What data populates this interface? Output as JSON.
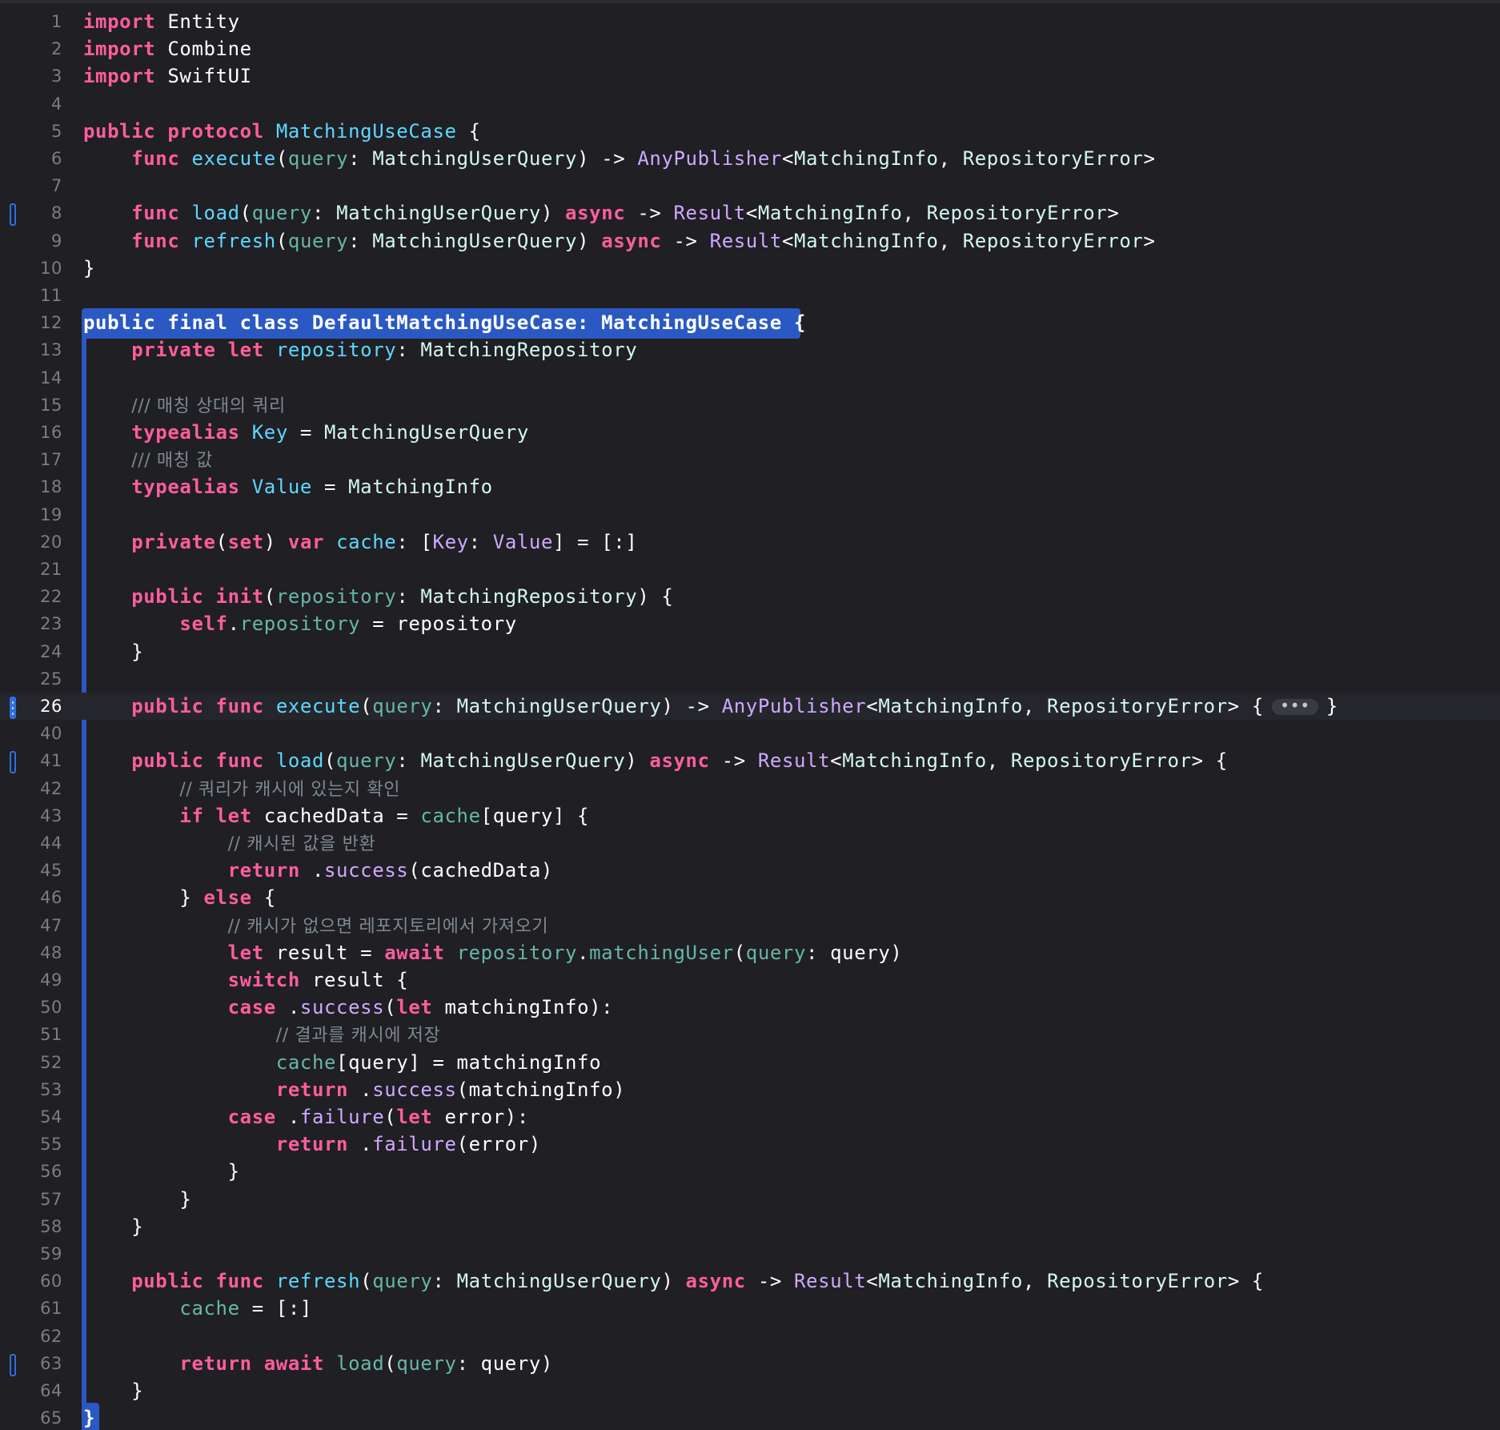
{
  "editor": {
    "language": "Swift",
    "fold_chip": "•••",
    "lines": [
      {
        "n": "1",
        "tokens": [
          [
            "kw",
            "import"
          ],
          [
            "pl",
            " Entity"
          ]
        ]
      },
      {
        "n": "2",
        "tokens": [
          [
            "kw",
            "import"
          ],
          [
            "pl",
            " Combine"
          ]
        ]
      },
      {
        "n": "3",
        "tokens": [
          [
            "kw",
            "import"
          ],
          [
            "pl",
            " SwiftUI"
          ]
        ]
      },
      {
        "n": "4",
        "tokens": []
      },
      {
        "n": "5",
        "tokens": [
          [
            "kw",
            "public protocol"
          ],
          [
            "pl",
            " "
          ],
          [
            "decl",
            "MatchingUseCase"
          ],
          [
            "pl",
            " {"
          ]
        ]
      },
      {
        "n": "6",
        "tokens": [
          [
            "pl",
            "    "
          ],
          [
            "kw",
            "func"
          ],
          [
            "pl",
            " "
          ],
          [
            "decl",
            "execute"
          ],
          [
            "pl",
            "("
          ],
          [
            "param",
            "query"
          ],
          [
            "pl",
            ": "
          ],
          [
            "ty",
            "MatchingUserQuery"
          ],
          [
            "pl",
            ") -> "
          ],
          [
            "sys",
            "AnyPublisher"
          ],
          [
            "pl",
            "<"
          ],
          [
            "ty",
            "MatchingInfo"
          ],
          [
            "pl",
            ", "
          ],
          [
            "ty",
            "RepositoryError"
          ],
          [
            "pl",
            ">"
          ]
        ]
      },
      {
        "n": "7",
        "tokens": []
      },
      {
        "n": "8",
        "marker": "bar",
        "tokens": [
          [
            "pl",
            "    "
          ],
          [
            "kw",
            "func"
          ],
          [
            "pl",
            " "
          ],
          [
            "decl",
            "load"
          ],
          [
            "pl",
            "("
          ],
          [
            "param",
            "query"
          ],
          [
            "pl",
            ": "
          ],
          [
            "ty",
            "MatchingUserQuery"
          ],
          [
            "pl",
            ") "
          ],
          [
            "kw",
            "async"
          ],
          [
            "pl",
            " -> "
          ],
          [
            "sys",
            "Result"
          ],
          [
            "pl",
            "<"
          ],
          [
            "ty",
            "MatchingInfo"
          ],
          [
            "pl",
            ", "
          ],
          [
            "ty",
            "RepositoryError"
          ],
          [
            "pl",
            ">"
          ]
        ]
      },
      {
        "n": "9",
        "tokens": [
          [
            "pl",
            "    "
          ],
          [
            "kw",
            "func"
          ],
          [
            "pl",
            " "
          ],
          [
            "decl",
            "refresh"
          ],
          [
            "pl",
            "("
          ],
          [
            "param",
            "query"
          ],
          [
            "pl",
            ": "
          ],
          [
            "ty",
            "MatchingUserQuery"
          ],
          [
            "pl",
            ") "
          ],
          [
            "kw",
            "async"
          ],
          [
            "pl",
            " -> "
          ],
          [
            "sys",
            "Result"
          ],
          [
            "pl",
            "<"
          ],
          [
            "ty",
            "MatchingInfo"
          ],
          [
            "pl",
            ", "
          ],
          [
            "ty",
            "RepositoryError"
          ],
          [
            "pl",
            ">"
          ]
        ]
      },
      {
        "n": "10",
        "tokens": [
          [
            "pl",
            "}"
          ]
        ]
      },
      {
        "n": "11",
        "tokens": []
      },
      {
        "n": "12",
        "highlight": true,
        "tokens": [
          [
            "hl",
            "public final class DefaultMatchingUseCase: MatchingUseCase {"
          ]
        ]
      },
      {
        "n": "13",
        "tokens": [
          [
            "pl",
            "    "
          ],
          [
            "kw",
            "private let"
          ],
          [
            "pl",
            " "
          ],
          [
            "decl",
            "repository"
          ],
          [
            "pl",
            ": "
          ],
          [
            "ty",
            "MatchingRepository"
          ]
        ]
      },
      {
        "n": "14",
        "tokens": []
      },
      {
        "n": "15",
        "tokens": [
          [
            "pl",
            "    "
          ],
          [
            "cm",
            "/// 매칭 상대의 쿼리"
          ]
        ]
      },
      {
        "n": "16",
        "tokens": [
          [
            "pl",
            "    "
          ],
          [
            "kw",
            "typealias"
          ],
          [
            "pl",
            " "
          ],
          [
            "decl",
            "Key"
          ],
          [
            "pl",
            " = "
          ],
          [
            "ty",
            "MatchingUserQuery"
          ]
        ]
      },
      {
        "n": "17",
        "tokens": [
          [
            "pl",
            "    "
          ],
          [
            "cm",
            "/// 매칭 값"
          ]
        ]
      },
      {
        "n": "18",
        "tokens": [
          [
            "pl",
            "    "
          ],
          [
            "kw",
            "typealias"
          ],
          [
            "pl",
            " "
          ],
          [
            "decl",
            "Value"
          ],
          [
            "pl",
            " = "
          ],
          [
            "ty",
            "MatchingInfo"
          ]
        ]
      },
      {
        "n": "19",
        "tokens": []
      },
      {
        "n": "20",
        "tokens": [
          [
            "pl",
            "    "
          ],
          [
            "kw",
            "private"
          ],
          [
            "pl",
            "("
          ],
          [
            "kw",
            "set"
          ],
          [
            "pl",
            ") "
          ],
          [
            "kw",
            "var"
          ],
          [
            "pl",
            " "
          ],
          [
            "decl",
            "cache"
          ],
          [
            "pl",
            ": ["
          ],
          [
            "sys",
            "Key"
          ],
          [
            "pl",
            ": "
          ],
          [
            "sys",
            "Value"
          ],
          [
            "pl",
            "] = [:]"
          ]
        ]
      },
      {
        "n": "21",
        "tokens": []
      },
      {
        "n": "22",
        "tokens": [
          [
            "pl",
            "    "
          ],
          [
            "kw",
            "public init"
          ],
          [
            "pl",
            "("
          ],
          [
            "param",
            "repository"
          ],
          [
            "pl",
            ": "
          ],
          [
            "ty",
            "MatchingRepository"
          ],
          [
            "pl",
            ") {"
          ]
        ]
      },
      {
        "n": "23",
        "tokens": [
          [
            "pl",
            "        "
          ],
          [
            "kw",
            "self"
          ],
          [
            "pl",
            "."
          ],
          [
            "param",
            "repository"
          ],
          [
            "pl",
            " = repository"
          ]
        ]
      },
      {
        "n": "24",
        "tokens": [
          [
            "pl",
            "    }"
          ]
        ]
      },
      {
        "n": "25",
        "tokens": []
      },
      {
        "n": "26",
        "current": true,
        "marker": "dots",
        "fold": true,
        "tokens": [
          [
            "pl",
            "    "
          ],
          [
            "kw",
            "public func"
          ],
          [
            "pl",
            " "
          ],
          [
            "decl",
            "execute"
          ],
          [
            "pl",
            "("
          ],
          [
            "param",
            "query"
          ],
          [
            "pl",
            ": "
          ],
          [
            "ty",
            "MatchingUserQuery"
          ],
          [
            "pl",
            ") -> "
          ],
          [
            "sys",
            "AnyPublisher"
          ],
          [
            "pl",
            "<"
          ],
          [
            "ty",
            "MatchingInfo"
          ],
          [
            "pl",
            ", "
          ],
          [
            "ty",
            "RepositoryError"
          ],
          [
            "pl",
            "> {"
          ],
          [
            "fold",
            ""
          ],
          [
            "pl",
            "}"
          ]
        ]
      },
      {
        "n": "40",
        "tokens": []
      },
      {
        "n": "41",
        "marker": "bar",
        "tokens": [
          [
            "pl",
            "    "
          ],
          [
            "kw",
            "public func"
          ],
          [
            "pl",
            " "
          ],
          [
            "decl",
            "load"
          ],
          [
            "pl",
            "("
          ],
          [
            "param",
            "query"
          ],
          [
            "pl",
            ": "
          ],
          [
            "ty",
            "MatchingUserQuery"
          ],
          [
            "pl",
            ") "
          ],
          [
            "kw",
            "async"
          ],
          [
            "pl",
            " -> "
          ],
          [
            "sys",
            "Result"
          ],
          [
            "pl",
            "<"
          ],
          [
            "ty",
            "MatchingInfo"
          ],
          [
            "pl",
            ", "
          ],
          [
            "ty",
            "RepositoryError"
          ],
          [
            "pl",
            "> {"
          ]
        ]
      },
      {
        "n": "42",
        "tokens": [
          [
            "pl",
            "        "
          ],
          [
            "cm",
            "// 쿼리가 캐시에 있는지 확인"
          ]
        ]
      },
      {
        "n": "43",
        "tokens": [
          [
            "pl",
            "        "
          ],
          [
            "kw",
            "if let"
          ],
          [
            "pl",
            " cachedData = "
          ],
          [
            "fn",
            "cache"
          ],
          [
            "pl",
            "[query] {"
          ]
        ]
      },
      {
        "n": "44",
        "tokens": [
          [
            "pl",
            "            "
          ],
          [
            "cm",
            "// 캐시된 값을 반환"
          ]
        ]
      },
      {
        "n": "45",
        "tokens": [
          [
            "pl",
            "            "
          ],
          [
            "kw",
            "return"
          ],
          [
            "pl",
            " ."
          ],
          [
            "sys",
            "success"
          ],
          [
            "pl",
            "(cachedData)"
          ]
        ]
      },
      {
        "n": "46",
        "tokens": [
          [
            "pl",
            "        } "
          ],
          [
            "kw",
            "else"
          ],
          [
            "pl",
            " {"
          ]
        ]
      },
      {
        "n": "47",
        "tokens": [
          [
            "pl",
            "            "
          ],
          [
            "cm",
            "// 캐시가 없으면 레포지토리에서 가져오기"
          ]
        ]
      },
      {
        "n": "48",
        "tokens": [
          [
            "pl",
            "            "
          ],
          [
            "kw",
            "let"
          ],
          [
            "pl",
            " result = "
          ],
          [
            "kw",
            "await"
          ],
          [
            "pl",
            " "
          ],
          [
            "fn",
            "repository"
          ],
          [
            "pl",
            "."
          ],
          [
            "fn",
            "matchingUser"
          ],
          [
            "pl",
            "("
          ],
          [
            "param",
            "query"
          ],
          [
            "pl",
            ": query)"
          ]
        ]
      },
      {
        "n": "49",
        "tokens": [
          [
            "pl",
            "            "
          ],
          [
            "kw",
            "switch"
          ],
          [
            "pl",
            " result {"
          ]
        ]
      },
      {
        "n": "50",
        "tokens": [
          [
            "pl",
            "            "
          ],
          [
            "kw",
            "case"
          ],
          [
            "pl",
            " ."
          ],
          [
            "sys",
            "success"
          ],
          [
            "pl",
            "("
          ],
          [
            "kw",
            "let"
          ],
          [
            "pl",
            " matchingInfo):"
          ]
        ]
      },
      {
        "n": "51",
        "tokens": [
          [
            "pl",
            "                "
          ],
          [
            "cm",
            "// 결과를 캐시에 저장"
          ]
        ]
      },
      {
        "n": "52",
        "tokens": [
          [
            "pl",
            "                "
          ],
          [
            "fn",
            "cache"
          ],
          [
            "pl",
            "[query] = matchingInfo"
          ]
        ]
      },
      {
        "n": "53",
        "tokens": [
          [
            "pl",
            "                "
          ],
          [
            "kw",
            "return"
          ],
          [
            "pl",
            " ."
          ],
          [
            "sys",
            "success"
          ],
          [
            "pl",
            "(matchingInfo)"
          ]
        ]
      },
      {
        "n": "54",
        "tokens": [
          [
            "pl",
            "            "
          ],
          [
            "kw",
            "case"
          ],
          [
            "pl",
            " ."
          ],
          [
            "sys",
            "failure"
          ],
          [
            "pl",
            "("
          ],
          [
            "kw",
            "let"
          ],
          [
            "pl",
            " error):"
          ]
        ]
      },
      {
        "n": "55",
        "tokens": [
          [
            "pl",
            "                "
          ],
          [
            "kw",
            "return"
          ],
          [
            "pl",
            " ."
          ],
          [
            "sys",
            "failure"
          ],
          [
            "pl",
            "(error)"
          ]
        ]
      },
      {
        "n": "56",
        "tokens": [
          [
            "pl",
            "            }"
          ]
        ]
      },
      {
        "n": "57",
        "tokens": [
          [
            "pl",
            "        }"
          ]
        ]
      },
      {
        "n": "58",
        "tokens": [
          [
            "pl",
            "    }"
          ]
        ]
      },
      {
        "n": "59",
        "tokens": []
      },
      {
        "n": "60",
        "tokens": [
          [
            "pl",
            "    "
          ],
          [
            "kw",
            "public func"
          ],
          [
            "pl",
            " "
          ],
          [
            "decl",
            "refresh"
          ],
          [
            "pl",
            "("
          ],
          [
            "param",
            "query"
          ],
          [
            "pl",
            ": "
          ],
          [
            "ty",
            "MatchingUserQuery"
          ],
          [
            "pl",
            ") "
          ],
          [
            "kw",
            "async"
          ],
          [
            "pl",
            " -> "
          ],
          [
            "sys",
            "Result"
          ],
          [
            "pl",
            "<"
          ],
          [
            "ty",
            "MatchingInfo"
          ],
          [
            "pl",
            ", "
          ],
          [
            "ty",
            "RepositoryError"
          ],
          [
            "pl",
            "> {"
          ]
        ]
      },
      {
        "n": "61",
        "tokens": [
          [
            "pl",
            "        "
          ],
          [
            "fn",
            "cache"
          ],
          [
            "pl",
            " = [:]"
          ]
        ]
      },
      {
        "n": "62",
        "tokens": []
      },
      {
        "n": "63",
        "marker": "bar",
        "tokens": [
          [
            "pl",
            "        "
          ],
          [
            "kw",
            "return await"
          ],
          [
            "pl",
            " "
          ],
          [
            "fn",
            "load"
          ],
          [
            "pl",
            "("
          ],
          [
            "param",
            "query"
          ],
          [
            "pl",
            ": query)"
          ]
        ]
      },
      {
        "n": "64",
        "tokens": [
          [
            "pl",
            "    }"
          ]
        ]
      },
      {
        "n": "65",
        "tokens": [
          [
            "hlend",
            "}"
          ]
        ]
      }
    ]
  },
  "colors": {
    "background": "#1f1f24",
    "keyword": "#ff5e9a",
    "type": "#d3f7f0",
    "declaration": "#5dd8ff",
    "function_call": "#67b7a4",
    "system_type": "#d0a8ff",
    "comment": "#7c8a8f",
    "selection": "#2b59c3"
  }
}
